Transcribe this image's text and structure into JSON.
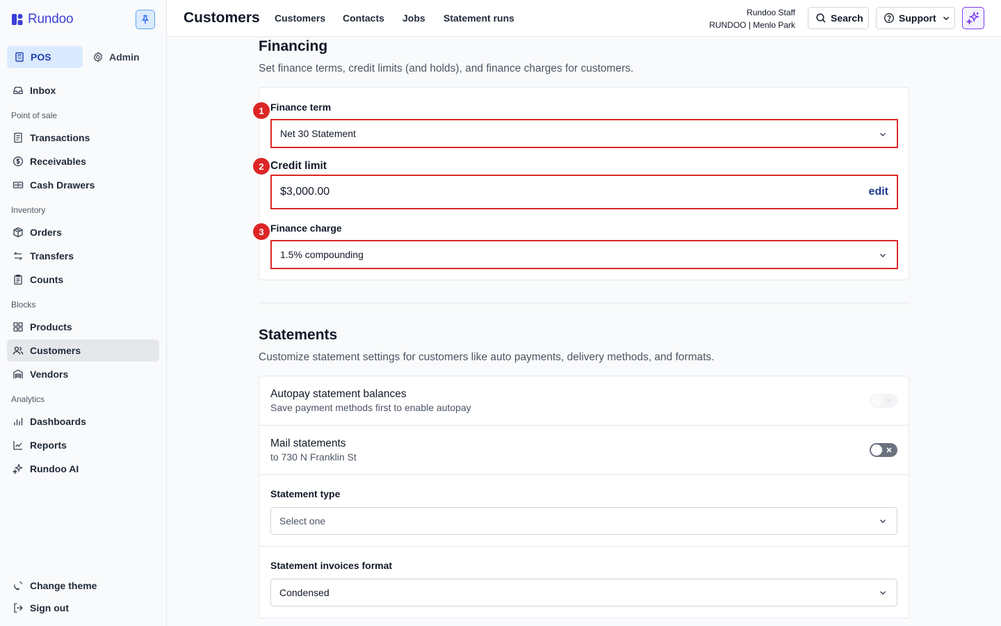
{
  "brand": {
    "name": "Rundoo"
  },
  "sidebar": {
    "modes": [
      {
        "label": "POS"
      },
      {
        "label": "Admin"
      }
    ],
    "inbox": {
      "label": "Inbox"
    },
    "sections": {
      "point_of_sale": "Point of sale",
      "inventory": "Inventory",
      "blocks": "Blocks",
      "analytics": "Analytics"
    },
    "items": {
      "transactions": "Transactions",
      "receivables": "Receivables",
      "cash_drawers": "Cash Drawers",
      "orders": "Orders",
      "transfers": "Transfers",
      "counts": "Counts",
      "products": "Products",
      "customers": "Customers",
      "vendors": "Vendors",
      "dashboards": "Dashboards",
      "reports": "Reports",
      "rundoo_ai": "Rundoo AI"
    },
    "footer": {
      "change_theme": "Change theme",
      "sign_out": "Sign out"
    }
  },
  "header": {
    "title": "Customers",
    "tabs": [
      {
        "label": "Customers"
      },
      {
        "label": "Contacts"
      },
      {
        "label": "Jobs"
      },
      {
        "label": "Statement runs"
      }
    ],
    "user": {
      "name": "Rundoo Staff",
      "org": "RUNDOO | Menlo Park"
    },
    "search_label": "Search",
    "support_label": "Support"
  },
  "financing": {
    "title": "Financing",
    "description": "Set finance terms, credit limits (and holds), and finance charges for customers.",
    "finance_term": {
      "label": "Finance term",
      "value": "Net 30 Statement",
      "badge": "1"
    },
    "credit_limit": {
      "label": "Credit limit",
      "value": "$3,000.00",
      "action": "edit",
      "badge": "2"
    },
    "finance_charge": {
      "label": "Finance charge",
      "value": "1.5% compounding",
      "badge": "3"
    }
  },
  "statements": {
    "title": "Statements",
    "description": "Customize statement settings for customers like auto payments, delivery methods, and formats.",
    "autopay": {
      "title": "Autopay statement balances",
      "subtitle": "Save payment methods first to enable autopay",
      "enabled": false,
      "disabled": true
    },
    "mail": {
      "title": "Mail statements",
      "subtitle": "to 730 N Franklin St",
      "enabled": false
    },
    "statement_type": {
      "label": "Statement type",
      "placeholder": "Select one"
    },
    "invoices_format": {
      "label": "Statement invoices format",
      "value": "Condensed"
    }
  },
  "colors": {
    "brand": "#3b3fd8",
    "annotation": "#dc2626",
    "link": "#1e3a8a",
    "accent_ai": "#7c3aed"
  }
}
